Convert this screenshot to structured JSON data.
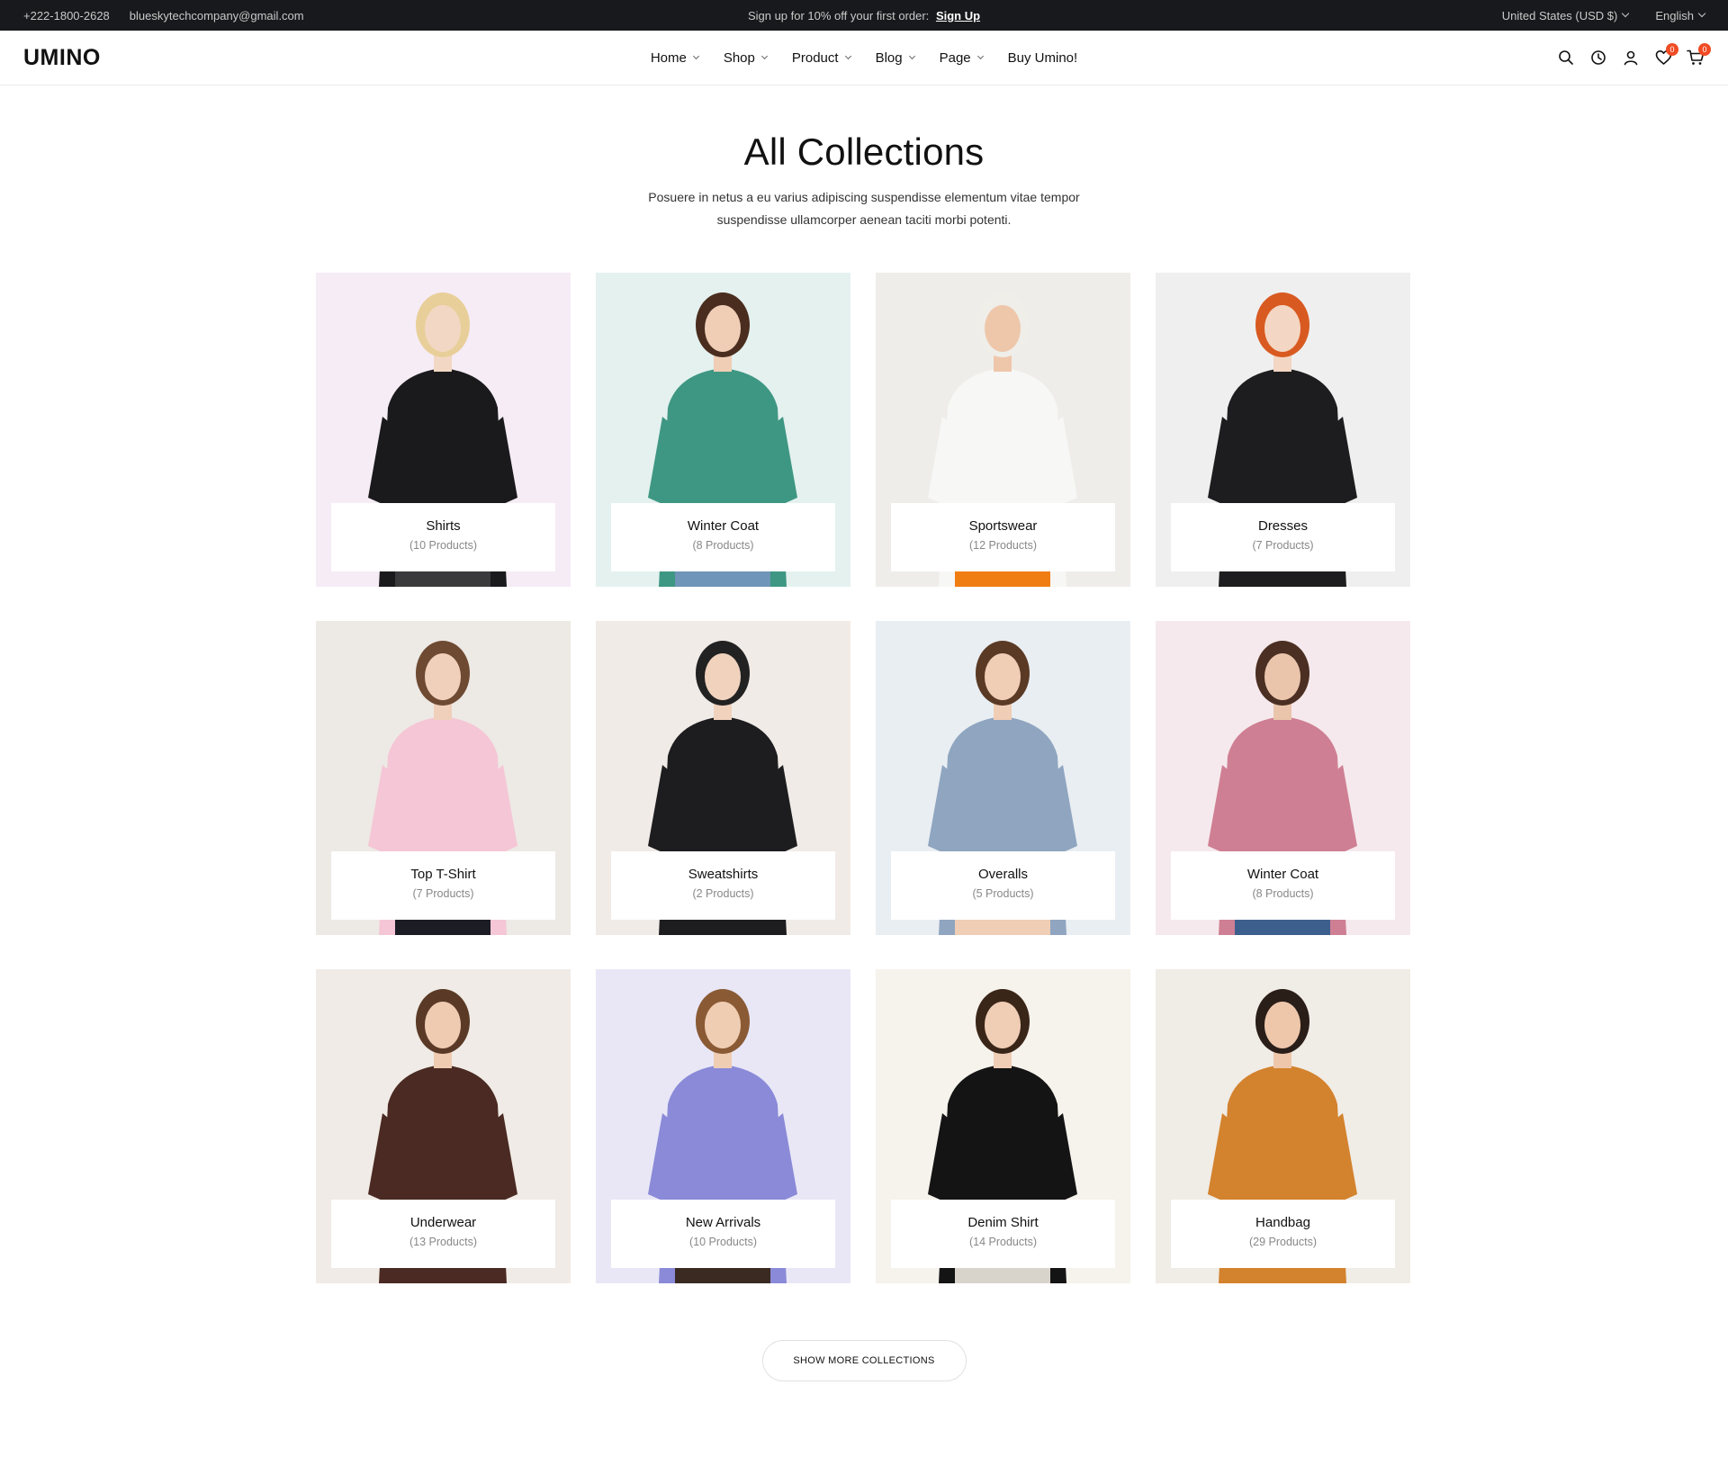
{
  "topbar": {
    "phone": "+222-1800-2628",
    "email": "blueskytechcompany@gmail.com",
    "promo_text": "Sign up for 10% off your first order:",
    "promo_link": "Sign Up",
    "currency": "United States (USD $)",
    "language": "English"
  },
  "header": {
    "logo": "UMINO",
    "nav": [
      {
        "label": "Home"
      },
      {
        "label": "Shop"
      },
      {
        "label": "Product"
      },
      {
        "label": "Blog"
      },
      {
        "label": "Page"
      },
      {
        "label": "Buy Umino!"
      }
    ],
    "wishlist_count": "0",
    "cart_count": "0",
    "icons": [
      "search-icon",
      "clock-icon",
      "user-icon",
      "heart-icon",
      "cart-icon"
    ]
  },
  "hero": {
    "title": "All Collections",
    "subtitle": "Posuere in netus a eu varius adipiscing suspendisse elementum vitae tempor suspendisse ullamcorper aenean taciti morbi potenti."
  },
  "collections": [
    {
      "name": "Shirts",
      "count": "(10 Products)",
      "bg": "#f6ecf5",
      "top": "#1a1a1c",
      "bottom": "#3a3a3c",
      "hair": "#e8cf9a",
      "skin": "#f2d8c4"
    },
    {
      "name": "Winter Coat",
      "count": "(8 Products)",
      "bg": "#e4f1ef",
      "top": "#3e9783",
      "bottom": "#6f95b8",
      "hair": "#4a2d1e",
      "skin": "#f0cdb5"
    },
    {
      "name": "Sportswear",
      "count": "(12 Products)",
      "bg": "#efedea",
      "top": "#f7f7f5",
      "bottom": "#f07d12",
      "hair": "#efeee9",
      "skin": "#eec7ab"
    },
    {
      "name": "Dresses",
      "count": "(7 Products)",
      "bg": "#efefef",
      "top": "#1d1d1f",
      "bottom": "#1d1d1f",
      "hair": "#d85a21",
      "skin": "#f3d6c3"
    },
    {
      "name": "Top T-Shirt",
      "count": "(7 Products)",
      "bg": "#ede9e5",
      "top": "#f5c6d6",
      "bottom": "#1b1c24",
      "hair": "#6e4a32",
      "skin": "#f0d0bb"
    },
    {
      "name": "Sweatshirts",
      "count": "(2 Products)",
      "bg": "#f0ebe7",
      "top": "#1d1d1f",
      "bottom": "#1d1d1f",
      "hair": "#222222",
      "skin": "#f0d2bd"
    },
    {
      "name": "Overalls",
      "count": "(5 Products)",
      "bg": "#e9eef2",
      "top": "#8fa5c0",
      "bottom": "#f0cdb5",
      "hair": "#5a3a25",
      "skin": "#f0cdb5"
    },
    {
      "name": "Winter Coat",
      "count": "(8 Products)",
      "bg": "#f5e9ed",
      "top": "#cf7f93",
      "bottom": "#3d5f8e",
      "hair": "#4b2f22",
      "skin": "#eac5ac"
    },
    {
      "name": "Underwear",
      "count": "(13 Products)",
      "bg": "#f0ebe6",
      "top": "#4a2a22",
      "bottom": "#4a2a22",
      "hair": "#5a3a26",
      "skin": "#efcbb1"
    },
    {
      "name": "New Arrivals",
      "count": "(10 Products)",
      "bg": "#e9e7f6",
      "top": "#8a8ad8",
      "bottom": "#3a2a22",
      "hair": "#8a5a34",
      "skin": "#efcdb3"
    },
    {
      "name": "Denim Shirt",
      "count": "(14 Products)",
      "bg": "#f6f2ec",
      "top": "#141414",
      "bottom": "#d8d4cc",
      "hair": "#3a2618",
      "skin": "#f0cdb5"
    },
    {
      "name": "Handbag",
      "count": "(29 Products)",
      "bg": "#f0ece6",
      "top": "#d3822d",
      "bottom": "#d3822d",
      "hair": "#2a1e18",
      "skin": "#eec7ab"
    }
  ],
  "show_more": "SHOW MORE COLLECTIONS"
}
